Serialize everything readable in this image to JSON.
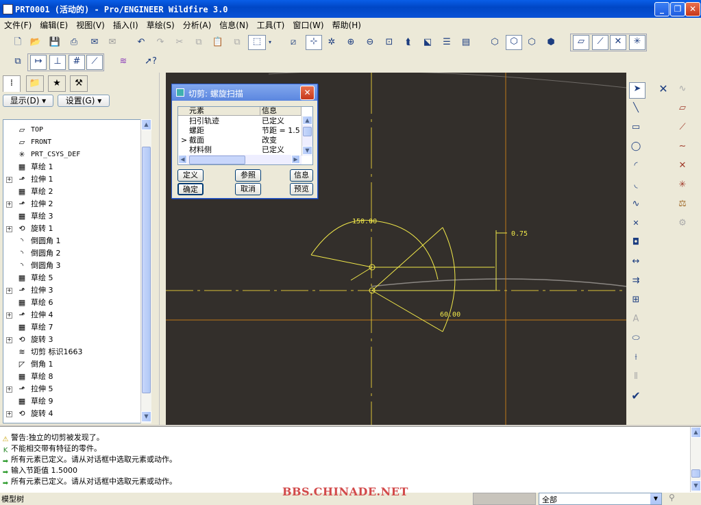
{
  "window": {
    "title": "PRT0001 (活动的) - Pro/ENGINEER Wildfire 3.0",
    "min_label": "_",
    "max_label": "❐",
    "close_label": "✕"
  },
  "menu": [
    "文件(F)",
    "编辑(E)",
    "视图(V)",
    "插入(I)",
    "草绘(S)",
    "分析(A)",
    "信息(N)",
    "工具(T)",
    "窗口(W)",
    "帮助(H)"
  ],
  "left_panel": {
    "show_button": "显示(D) ▾",
    "settings_button": "设置(G) ▾",
    "tree_items": [
      {
        "label": "TOP",
        "icon": "datum-plane-icon",
        "glyph": "▱",
        "expand": false,
        "mono": true
      },
      {
        "label": "FRONT",
        "icon": "datum-plane-icon",
        "glyph": "▱",
        "expand": false,
        "mono": true
      },
      {
        "label": "PRT_CSYS_DEF",
        "icon": "csys-icon",
        "glyph": "✳",
        "expand": false,
        "mono": true
      },
      {
        "label": "草绘 1",
        "icon": "sketch-icon",
        "glyph": "▦",
        "expand": false
      },
      {
        "label": "拉伸 1",
        "icon": "extrude-icon",
        "glyph": "⬏",
        "expand": true
      },
      {
        "label": "草绘 2",
        "icon": "sketch-icon",
        "glyph": "▦",
        "expand": false
      },
      {
        "label": "拉伸 2",
        "icon": "extrude-icon",
        "glyph": "⬏",
        "expand": true
      },
      {
        "label": "草绘 3",
        "icon": "sketch-icon",
        "glyph": "▦",
        "expand": false
      },
      {
        "label": "旋转 1",
        "icon": "revolve-icon",
        "glyph": "⟲",
        "expand": true
      },
      {
        "label": "倒圆角 1",
        "icon": "round-icon",
        "glyph": "◝",
        "expand": false
      },
      {
        "label": "倒圆角 2",
        "icon": "round-icon",
        "glyph": "◝",
        "expand": false
      },
      {
        "label": "倒圆角 3",
        "icon": "round-icon",
        "glyph": "◝",
        "expand": false
      },
      {
        "label": "草绘 5",
        "icon": "sketch-icon",
        "glyph": "▦",
        "expand": false
      },
      {
        "label": "拉伸 3",
        "icon": "extrude-icon",
        "glyph": "⬏",
        "expand": true
      },
      {
        "label": "草绘 6",
        "icon": "sketch-icon",
        "glyph": "▦",
        "expand": false
      },
      {
        "label": "拉伸 4",
        "icon": "extrude-icon",
        "glyph": "⬏",
        "expand": true
      },
      {
        "label": "草绘 7",
        "icon": "sketch-icon",
        "glyph": "▦",
        "expand": false
      },
      {
        "label": "旋转 3",
        "icon": "revolve-icon",
        "glyph": "⟲",
        "expand": true
      },
      {
        "label": "切剪 标识1663",
        "icon": "helical-cut-icon",
        "glyph": "≋",
        "expand": false
      },
      {
        "label": "倒角 1",
        "icon": "chamfer-icon",
        "glyph": "◸",
        "expand": false
      },
      {
        "label": "草绘 8",
        "icon": "sketch-icon",
        "glyph": "▦",
        "expand": false
      },
      {
        "label": "拉伸 5",
        "icon": "extrude-icon",
        "glyph": "⬏",
        "expand": true
      },
      {
        "label": "草绘 9",
        "icon": "sketch-icon",
        "glyph": "▦",
        "expand": false
      },
      {
        "label": "旋转 4",
        "icon": "revolve-icon",
        "glyph": "⟲",
        "expand": true
      }
    ]
  },
  "dialog": {
    "title": "切剪: 螺旋扫描",
    "col_element": "元素",
    "col_info": "信息",
    "rows": [
      {
        "marker": "",
        "element": "扫引轨迹",
        "info": "已定义"
      },
      {
        "marker": "",
        "element": "螺距",
        "info": "节距 = 1.5"
      },
      {
        "marker": ">",
        "element": "截面",
        "info": "改变"
      },
      {
        "marker": "",
        "element": "材料侧",
        "info": "已定义"
      }
    ],
    "buttons": {
      "define": "定义",
      "refs": "参照",
      "info": "信息",
      "ok": "确定",
      "cancel": "取消",
      "preview": "预览"
    }
  },
  "sketch": {
    "dim_angle_top": "150.00",
    "dim_angle_bottom": "60.00",
    "dim_length": "0.75"
  },
  "messages": [
    {
      "icon": "warning-icon",
      "glyph": "⚠",
      "color": "#c8a000",
      "text": "警告:独立的切剪被发现了。"
    },
    {
      "icon": "info-icon",
      "glyph": "K",
      "color": "#2a8a2a",
      "text": "不能相交带有特征的零件。"
    },
    {
      "icon": "prompt-arrow-icon",
      "glyph": "➡",
      "color": "#2a9a2a",
      "text": "所有元素已定义。请从对话框中选取元素或动作。"
    },
    {
      "icon": "prompt-arrow-icon",
      "glyph": "➡",
      "color": "#2a9a2a",
      "text": "输入节距值    1.5000"
    },
    {
      "icon": "prompt-arrow-icon",
      "glyph": "➡",
      "color": "#2a9a2a",
      "text": "所有元素已定义。请从对话框中选取元素或动作。"
    }
  ],
  "status": {
    "left_label": "模型树",
    "filter_value": "全部",
    "watermark": "BBS.CHINADE.NET"
  },
  "colors": {
    "graphics_bg": "#332f2b",
    "sketch_yellow": "#f2e94a",
    "sketch_center": "#d8c23a",
    "axis_orange": "#d2891a"
  }
}
